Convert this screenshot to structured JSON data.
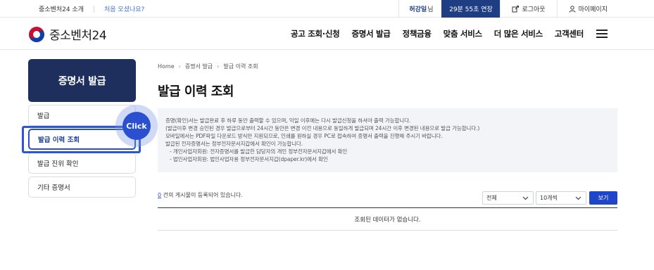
{
  "topbar": {
    "about": "중소벤처24 소개",
    "first_visit": "처음 오셨나요?",
    "user_name": "허강일",
    "user_suffix": "님",
    "timer": "29분 55초 연장",
    "logout": "로그아웃",
    "mypage": "마이페이지"
  },
  "header": {
    "logo_text": "중소벤처24",
    "nav": [
      "공고 조회·신청",
      "증명서 발급",
      "정책금융",
      "맞춤 서비스",
      "더 많은 서비스",
      "고객센터"
    ]
  },
  "sidebar": {
    "title": "증명서 발급",
    "items": [
      "발급",
      "발급 이력 조회",
      "발급 진위 확인",
      "기타 증명서"
    ],
    "active_index": 1
  },
  "overlay": {
    "click_label": "Click"
  },
  "breadcrumb": [
    "Home",
    "증명서 발급",
    "발급 이력 조회"
  ],
  "page_title": "발급 이력 조회",
  "notice": [
    "증명(확인)서는 발급완료 후 하루 동안 출력할 수 있으며, 익일 이후에는 다시 발급신청을 하셔야 출력 가능합니다.",
    "(발급이후 변경 승인된 경우 발급으로부터 24시간 동안은 변경 이전 내용으로 동일하게 발급되며 24시간 이후 변경된 내용으로 발급 가능합니다.)",
    "모바일에서는 PDF파일 다운로드 방식만 지원되므로, 인쇄를 원하실 경우 PC로 접속하여 증명서 출력을 진행해 주시기 바랍니다.",
    "발급된 전자증명서는 정부전자문서지갑에서 확인이 가능합니다.",
    "- 개인사업자회원: 전자증명서를 발급한 담당자의 개인 정부전자문서지갑에서 확인",
    "- 법인사업자회원: 법인사업자용 정부전자문서지갑(dpaper.kr)에서 확인"
  ],
  "list": {
    "count": "0",
    "count_suffix": "건의 게시물이 등록되어 있습니다.",
    "filter_value": "전체",
    "page_size_value": "10개씩",
    "view_button": "보기",
    "empty_message": "조회된 데이터가 없습니다."
  },
  "colors": {
    "brand_navy": "#1e2f5e",
    "accent_blue": "#2a4fcf",
    "timer_bg": "#1f3d83"
  }
}
